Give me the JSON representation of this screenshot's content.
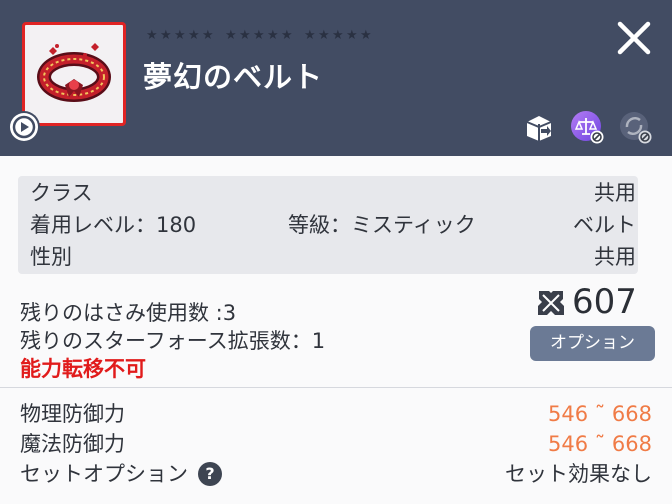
{
  "item": {
    "name": "夢幻のベルト",
    "star_groups": [
      5,
      5,
      5
    ],
    "frame_color": "#e02424"
  },
  "header": {
    "close_icon": "close-icon",
    "badges": [
      "transfer-box-icon",
      "scale-icon",
      "refresh-disabled-icon"
    ]
  },
  "info": {
    "class_label": "クラス",
    "class_value": "共用",
    "req_level": "着用レベル：180",
    "grade": "等級：ミスティック",
    "type": "ベルト",
    "gender_label": "性別",
    "gender_value": "共用"
  },
  "upgrade": {
    "scissors": "残りのはさみ使用数 :3",
    "starforce": "残りのスターフォース拡張数：1",
    "transfer": "能力転移不可",
    "power": "607",
    "option_button": "オプション"
  },
  "stats": {
    "phys_def_label": "物理防御力",
    "phys_def_value": "546 ˜ 668",
    "mag_def_label": "魔法防御力",
    "mag_def_value": "546 ˜ 668",
    "set_option_label": "セットオプション",
    "set_option_help": "?",
    "set_option_value": "セット効果なし"
  },
  "colors": {
    "header_bg": "#424c63",
    "stat_value": "#f07b46",
    "warning": "#e11b1b",
    "button_bg": "#6b7a95"
  }
}
